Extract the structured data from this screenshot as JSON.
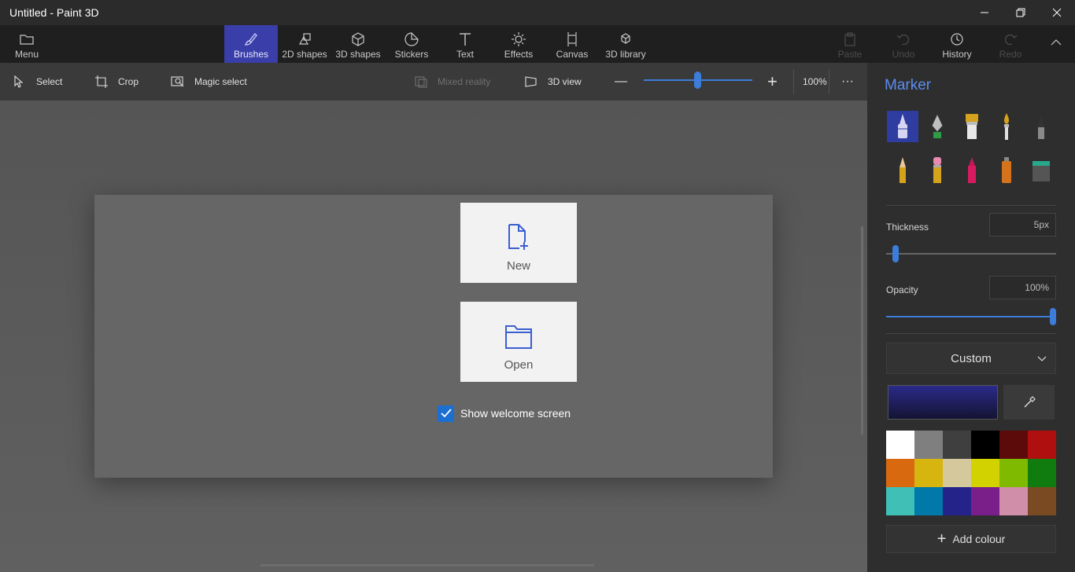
{
  "window": {
    "title": "Untitled - Paint 3D"
  },
  "ribbon": {
    "menu": "Menu",
    "tabs": [
      "Brushes",
      "2D shapes",
      "3D shapes",
      "Stickers",
      "Text",
      "Effects",
      "Canvas",
      "3D library"
    ],
    "active_tab": "Brushes",
    "actions": [
      "Paste",
      "Undo",
      "History",
      "Redo"
    ]
  },
  "toolbar": {
    "select": "Select",
    "crop": "Crop",
    "magic_select": "Magic select",
    "mixed_reality": "Mixed reality",
    "view_3d": "3D view",
    "zoom_minus": "—",
    "zoom_plus": "+",
    "zoom_level": "100%",
    "more": "···"
  },
  "welcome": {
    "new_label": "New",
    "open_label": "Open",
    "show_welcome": "Show welcome screen",
    "show_welcome_checked": true
  },
  "panel": {
    "title": "Marker",
    "brushes": [
      "marker",
      "calligraphy-pen",
      "oil-brush",
      "watercolor",
      "pixel-pen",
      "pencil",
      "eraser",
      "crayon",
      "spray-can",
      "fill"
    ],
    "thickness_label": "Thickness",
    "thickness_value": "5px",
    "opacity_label": "Opacity",
    "opacity_value": "100%",
    "color_mode": "Custom",
    "add_colour": "Add colour",
    "current_color": "#1c1c5e",
    "palette": [
      "#ffffff",
      "#7f7f7f",
      "#3f3f3f",
      "#000000",
      "#5c0a0a",
      "#b00f0f",
      "#d9690f",
      "#d6b50f",
      "#d4c89c",
      "#d2d200",
      "#7fba00",
      "#107c10",
      "#3fbfb6",
      "#0078a8",
      "#23238a",
      "#7a1f8a",
      "#d18ea8",
      "#7a4a22"
    ]
  }
}
